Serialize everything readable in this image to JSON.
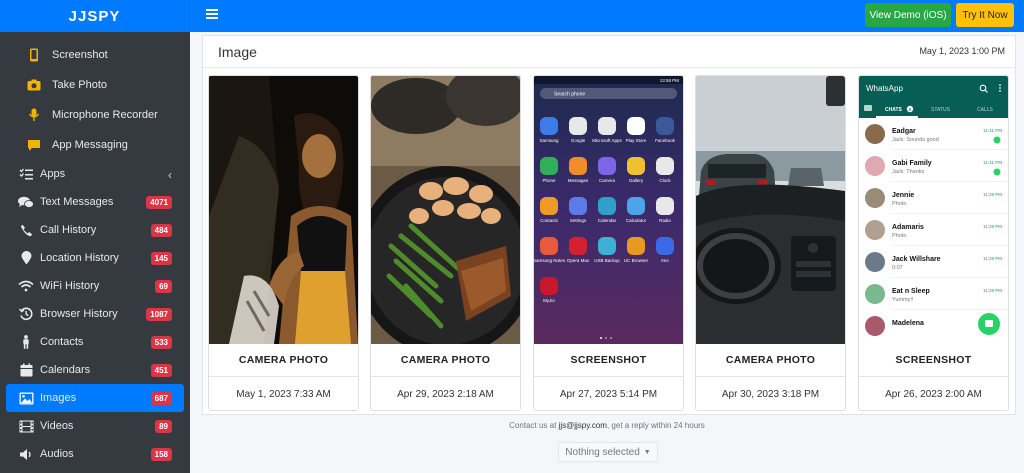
{
  "brand": "JJSPY",
  "topbar": {
    "demo_label": "View Demo (iOS)",
    "try_label": "Try It Now",
    "colors": {
      "primary": "#007bff",
      "demo": "#28a745",
      "try": "#ffc107"
    }
  },
  "sidebar": {
    "items": [
      {
        "label": "Screenshot",
        "icon": "phone-icon",
        "sub": true
      },
      {
        "label": "Take Photo",
        "icon": "camera-rotate-icon",
        "sub": true
      },
      {
        "label": "Microphone Recorder",
        "icon": "microphone-icon",
        "sub": true
      },
      {
        "label": "App Messaging",
        "icon": "message-icon",
        "sub": true
      },
      {
        "label": "Apps",
        "icon": "tasks-icon",
        "chevron": true
      },
      {
        "label": "Text Messages",
        "icon": "comments-icon",
        "badge": "4071"
      },
      {
        "label": "Call History",
        "icon": "phone-handset-icon",
        "badge": "484"
      },
      {
        "label": "Location History",
        "icon": "map-marker-icon",
        "badge": "145"
      },
      {
        "label": "WiFi History",
        "icon": "wifi-icon",
        "badge": "69"
      },
      {
        "label": "Browser History",
        "icon": "history-icon",
        "badge": "1087"
      },
      {
        "label": "Contacts",
        "icon": "person-icon",
        "badge": "533"
      },
      {
        "label": "Calendars",
        "icon": "calendar-icon",
        "badge": "451"
      },
      {
        "label": "Images",
        "icon": "image-icon",
        "badge": "687",
        "active": true
      },
      {
        "label": "Videos",
        "icon": "film-icon",
        "badge": "89"
      },
      {
        "label": "Audios",
        "icon": "audio-icon",
        "badge": "158"
      }
    ]
  },
  "main": {
    "title": "Image",
    "date": "May 1, 2023 1:00 PM",
    "tiles": [
      {
        "type": "CAMERA PHOTO",
        "date": "May 1, 2023 7:33 AM"
      },
      {
        "type": "CAMERA PHOTO",
        "date": "Apr 29, 2023 2:18 AM"
      },
      {
        "type": "SCREENSHOT",
        "date": "Apr 27, 2023 5:14 PM"
      },
      {
        "type": "CAMERA PHOTO",
        "date": "Apr 30, 2023 3:18 PM"
      },
      {
        "type": "SCREENSHOT",
        "date": "Apr 26, 2023 2:00 AM"
      }
    ]
  },
  "phone_screen": {
    "status": "13:58 PM",
    "search_placeholder": "Search phone",
    "apps": [
      "Samsung",
      "Google",
      "Microsoft Apps",
      "Play Store",
      "Facebook",
      "Phone",
      "Messages",
      "Camera",
      "Gallery",
      "Clock",
      "Contacts",
      "Settings",
      "Calendar",
      "Calculator",
      "Radio",
      "Samsung Notes",
      "Opera Max",
      "USB Backup",
      "UC Browser",
      "Imo",
      "MyJio"
    ]
  },
  "whatsapp": {
    "title": "WhatsApp",
    "tabs": [
      "CHATS",
      "STATUS",
      "CALLS"
    ],
    "chats_badge": "5",
    "chats": [
      {
        "name": "Eadgar",
        "msg": "Jack: Sounds good",
        "time": "11:31 PM"
      },
      {
        "name": "Gabi Family",
        "msg": "Jack: Thanks",
        "time": "11:31 PM"
      },
      {
        "name": "Jennie",
        "msg": "Photo",
        "time": "11:29 PM"
      },
      {
        "name": "Adamaris",
        "msg": "Photo",
        "time": "11:29 PM"
      },
      {
        "name": "Jack Willshare",
        "msg": "0:07",
        "time": "11:29 PM"
      },
      {
        "name": "Eat n Sleep",
        "msg": "Yummy!!",
        "time": "11:29 PM"
      },
      {
        "name": "Madelena",
        "msg": "",
        "time": ""
      }
    ]
  },
  "footer": {
    "contact_prefix": "Contact us at",
    "contact_email": "jjs@jjspy.com",
    "contact_suffix": ", get a reply within 24 hours",
    "select_label": "Nothing selected"
  }
}
